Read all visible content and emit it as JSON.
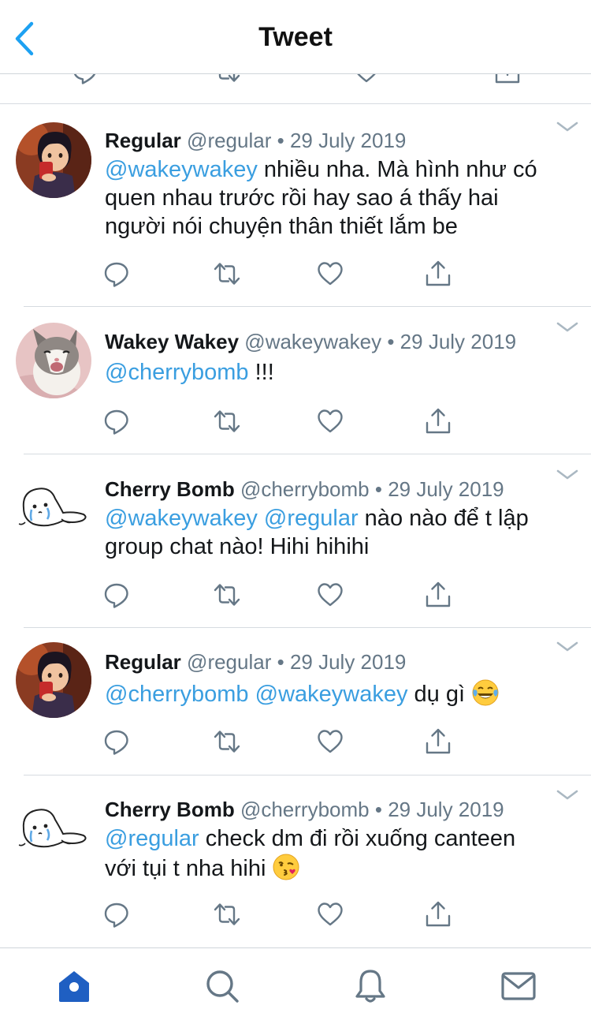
{
  "header": {
    "title": "Tweet",
    "back_icon": "chevron-left-icon"
  },
  "tweets": [
    {
      "name": "Regular",
      "handle": "@regular",
      "dot": "•",
      "date": "29 July 2019",
      "mentions": [
        "@wakeywakey"
      ],
      "line1_rest": " nhiều nha. Mà hình như có",
      "line2": "quen nhau trước rồi hay sao á thấy hai",
      "line3": "người nói chuyện thân thiết lắm be"
    },
    {
      "name": "Wakey Wakey",
      "handle": "@wakeywakey",
      "dot": "•",
      "date": "29 July 2019",
      "mentions": [
        "@cherrybomb"
      ],
      "line1_rest": " !!!"
    },
    {
      "name": "Cherry Bomb",
      "handle": "@cherrybomb",
      "dot": "•",
      "date": "29 July 2019",
      "mentions": [
        "@wakeywakey",
        "@regular"
      ],
      "line1_rest": " nào nào để t lập",
      "line2": "group chat nào! Hihi hihihi"
    },
    {
      "name": "Regular",
      "handle": "@regular",
      "dot": "•",
      "date": "29 July 2019",
      "mentions": [
        "@cherrybomb",
        "@wakeywakey"
      ],
      "line1_rest": " dụ gì ",
      "emoji": "tears-of-joy-emoji"
    },
    {
      "name": "Cherry Bomb",
      "handle": "@cherrybomb",
      "dot": "•",
      "date": "29 July 2019",
      "mentions": [
        "@regular"
      ],
      "line1_rest": " check dm đi rồi xuống canteen",
      "line2": "với tụi t nha hihi ",
      "emoji": "blowing-kiss-emoji"
    }
  ],
  "action_icons": [
    "reply-icon",
    "retweet-icon",
    "like-icon",
    "share-icon"
  ],
  "tabbar": {
    "icons": [
      "home-icon",
      "search-icon",
      "notifications-icon",
      "messages-icon"
    ],
    "active": "home"
  },
  "colors": {
    "accent": "#1da1f2",
    "mention": "#3a9ee0",
    "text": "#14171a",
    "meta": "#657786",
    "tab_active": "#1f5fc2",
    "tab_inactive": "#657786"
  }
}
